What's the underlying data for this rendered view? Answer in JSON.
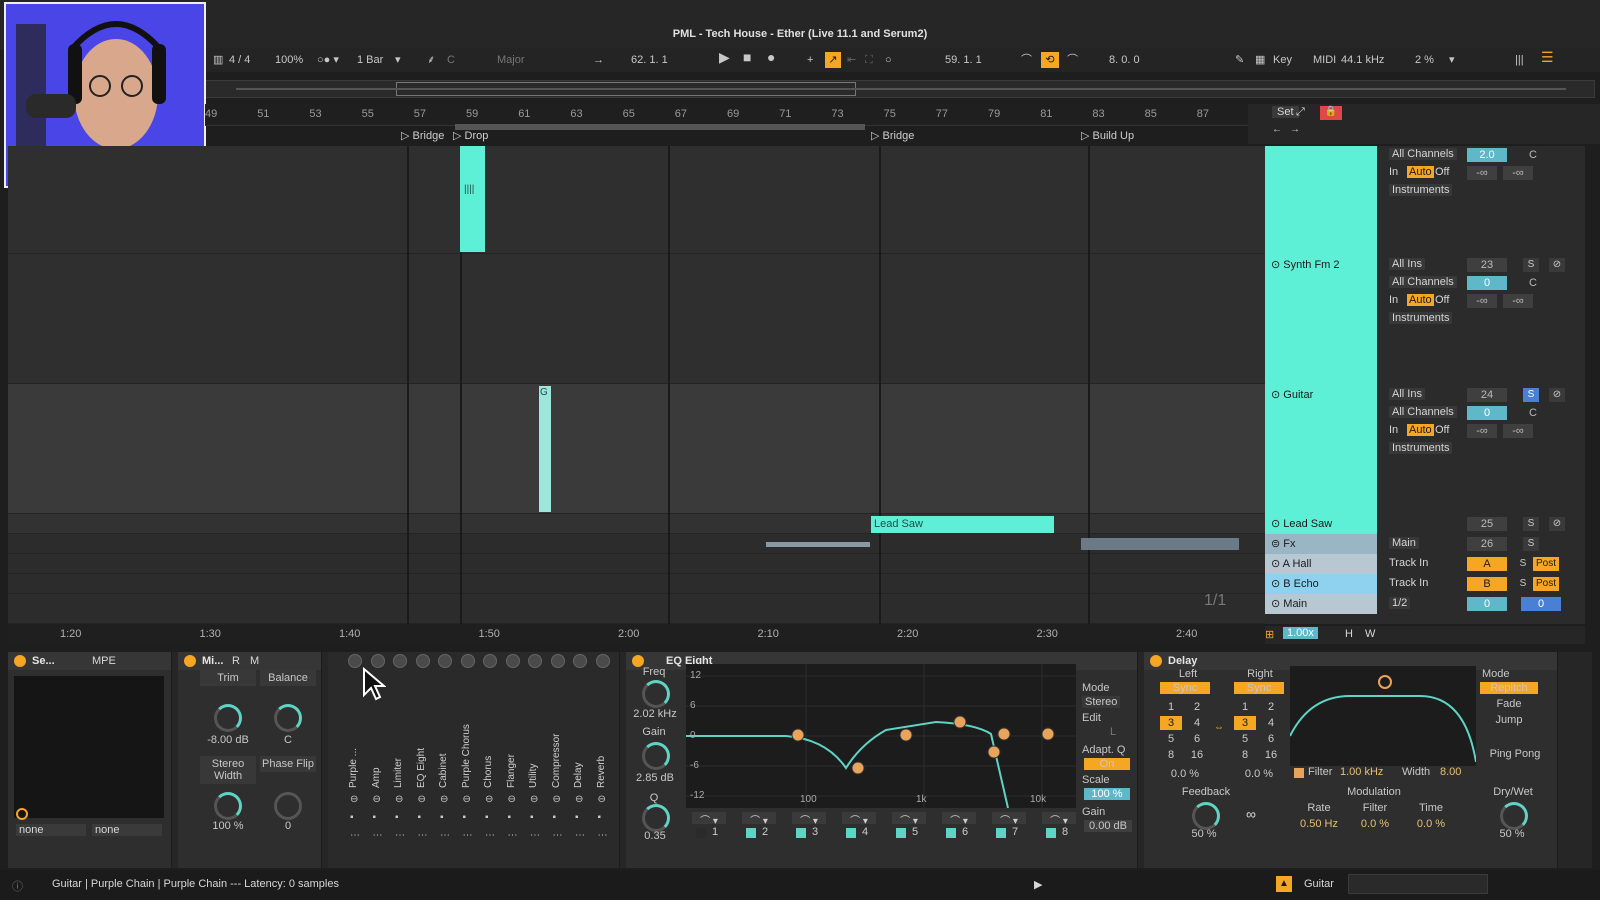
{
  "title": "PML - Tech House - Ether (Live 11.1 and Serum2)",
  "transport": {
    "time_sig": "4 / 4",
    "zoom": "100%",
    "quantize": "1 Bar",
    "key_root": "C",
    "scale": "Major",
    "position": "62.  1.  1",
    "loop_start": "59.  1.  1",
    "loop_length": "8.  0.  0",
    "key_label": "Key",
    "midi_label": "MIDI",
    "sample_rate": "44.1 kHz",
    "cpu": "2 %"
  },
  "ruler": [
    "49",
    "51",
    "53",
    "55",
    "57",
    "59",
    "61",
    "63",
    "65",
    "67",
    "69",
    "71",
    "73",
    "75",
    "77",
    "79",
    "81",
    "83",
    "85",
    "87"
  ],
  "locators": [
    "Bridge",
    "Drop",
    "Bridge",
    "Build Up"
  ],
  "clips": {
    "lead_saw": "Lead Saw",
    "guitar_short": "G"
  },
  "timeline": [
    "1:20",
    "1:30",
    "1:40",
    "1:50",
    "2:00",
    "2:10",
    "2:20",
    "2:30",
    "2:40"
  ],
  "page_indicator": "1/1",
  "zoom_factor": "1.00x",
  "set_label": "Set",
  "tracks": [
    {
      "name": "",
      "in": "All Channels",
      "monitor": [
        "In",
        "Auto",
        "Off"
      ],
      "out": "Instruments",
      "vol": "2.0",
      "pan": "C",
      "s1": "-∞",
      "s2": "-∞"
    },
    {
      "name": "Synth Fm 2",
      "in": "All Ins",
      "ch": "All Channels",
      "monitor": [
        "In",
        "Auto",
        "Off"
      ],
      "out": "Instruments",
      "num": "23",
      "vol": "0",
      "pan": "C",
      "solo": "S",
      "s1": "-∞",
      "s2": "-∞"
    },
    {
      "name": "Guitar",
      "in": "All Ins",
      "ch": "All Channels",
      "monitor": [
        "In",
        "Auto",
        "Off"
      ],
      "out": "Instruments",
      "num": "24",
      "vol": "0",
      "pan": "C",
      "solo": "S",
      "s1": "-∞",
      "s2": "-∞"
    },
    {
      "name": "Lead Saw",
      "num": "25",
      "solo": "S"
    },
    {
      "name": "Fx",
      "out": "Main",
      "num": "26",
      "solo": "S"
    },
    {
      "name": "A Hall",
      "in": "Track In",
      "send": "A",
      "solo": "S",
      "post": "Post"
    },
    {
      "name": "B Echo",
      "in": "Track In",
      "send": "B",
      "solo": "S",
      "post": "Post"
    },
    {
      "name": "Main",
      "out": "1/2",
      "vol": "0",
      "pan": "0"
    }
  ],
  "h_label": "H",
  "w_label": "W",
  "devices": {
    "sampler": {
      "title": "Se...",
      "mpe": "MPE",
      "none1": "none",
      "none2": "none"
    },
    "mixer": {
      "title": "Mi...",
      "r": "R",
      "m": "M",
      "trim": "Trim",
      "balance": "Balance",
      "trim_val": "-8.00 dB",
      "bal_val": "C",
      "stereo": "Stereo Width",
      "phase": "Phase Flip",
      "stereo_val": "100 %",
      "phase_val": "0"
    },
    "chain": [
      "Purple ...",
      "Amp",
      "Limiter",
      "EQ Eight",
      "Cabinet",
      "Purple Chorus",
      "Chorus",
      "Flanger",
      "Utility",
      "Compressor",
      "Delay",
      "Reverb"
    ],
    "eq": {
      "title": "EQ Eight",
      "freq": "Freq",
      "freq_val": "2.02 kHz",
      "gain": "Gain",
      "gain_val": "2.85 dB",
      "q": "Q",
      "q_val": "0.35",
      "mode": "Mode",
      "mode_val": "Stereo",
      "edit": "Edit",
      "edit_val": "L",
      "adapt": "Adapt. Q",
      "adapt_val": "On",
      "scale": "Scale",
      "scale_val": "100 %",
      "gain_out": "Gain",
      "gain_out_val": "0.00 dB",
      "y_ticks": [
        "12",
        "6",
        "0",
        "-6",
        "-12"
      ],
      "x_ticks": [
        "100",
        "1k",
        "10k"
      ],
      "bands": [
        "1",
        "2",
        "3",
        "4",
        "5",
        "6",
        "7",
        "8"
      ]
    },
    "delay": {
      "title": "Delay",
      "left": "Left",
      "right": "Right",
      "sync": "Sync",
      "grid": [
        "1",
        "2",
        "3",
        "4",
        "5",
        "6",
        "8",
        "16"
      ],
      "left_pct": "0.0 %",
      "right_pct": "0.0 %",
      "filter": "Filter",
      "filter_val": "1.00 kHz",
      "width": "Width",
      "width_val": "8.00",
      "mode": "Mode",
      "repitch": "Repitch",
      "fade": "Fade",
      "jump": "Jump",
      "pingpong": "Ping Pong",
      "feedback": "Feedback",
      "feedback_val": "50 %",
      "modulation": "Modulation",
      "rate": "Rate",
      "rate_val": "0.50 Hz",
      "filter2": "Filter",
      "filter2_val": "0.0 %",
      "time": "Time",
      "time_val": "0.0 %",
      "drywet": "Dry/Wet",
      "drywet_val": "50 %"
    }
  },
  "status": {
    "text": "Guitar | Purple Chain | Purple Chain --- Latency: 0 samples",
    "track": "Guitar"
  },
  "colors": {
    "clip": "#5ef0d6",
    "accent": "#f5a623",
    "bg": "#1e1e1e"
  }
}
